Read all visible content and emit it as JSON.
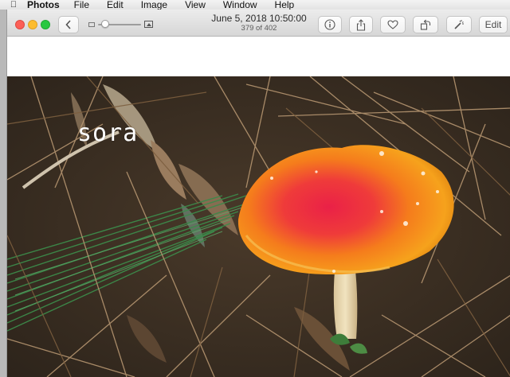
{
  "menubar": {
    "apple_icon": "apple-logo-icon",
    "items": [
      "Photos",
      "File",
      "Edit",
      "Image",
      "View",
      "Window",
      "Help"
    ]
  },
  "toolbar": {
    "back_icon": "chevron-left-icon",
    "zoom_slider_value": 0.1,
    "title_date": "June 5, 2018 10:50:00",
    "title_count": "379 of 402",
    "info_icon": "info-icon",
    "share_icon": "share-icon",
    "favorite_icon": "heart-icon",
    "rotate_icon": "rotate-icon",
    "enhance_icon": "magic-wand-icon",
    "edit_label": "Edit"
  },
  "photo": {
    "watermark": "sora"
  },
  "colors": {
    "close": "#fc5f57",
    "minimize": "#fdbc2e",
    "zoom": "#28c840",
    "mushroom_cap": "#f28a16",
    "mushroom_center": "#e8263f"
  }
}
